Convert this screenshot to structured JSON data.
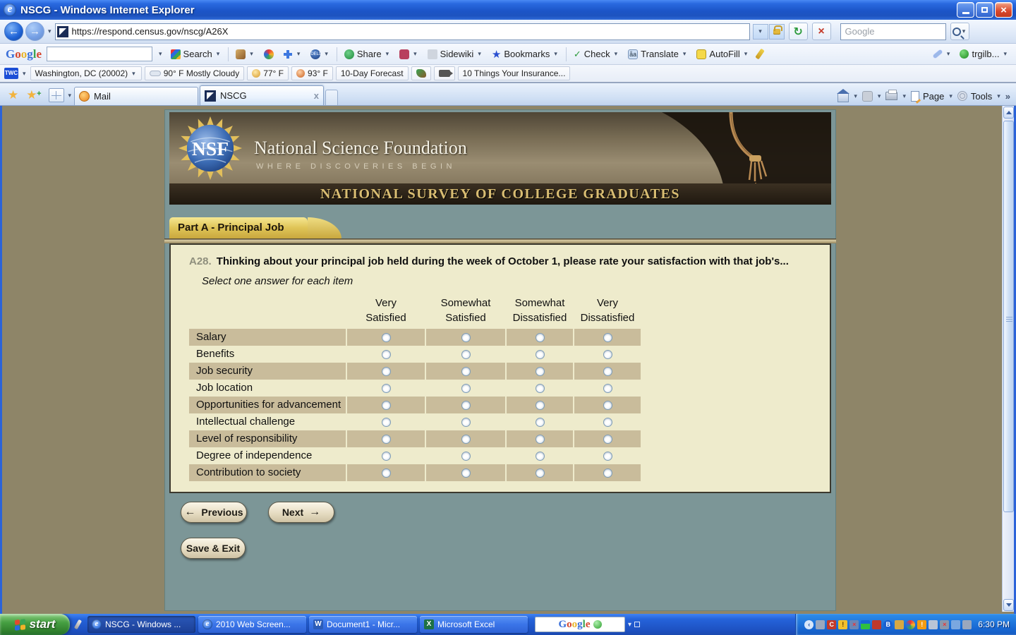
{
  "window": {
    "title": "NSCG - Windows Internet Explorer"
  },
  "nav": {
    "url": "https://respond.census.gov/nscg/A26X",
    "search_placeholder": "Google"
  },
  "google_toolbar": {
    "logo": "Google",
    "search_label": "Search",
    "share_label": "Share",
    "sidewiki_label": "Sidewiki",
    "bookmarks_label": "Bookmarks",
    "check_label": "Check",
    "translate_label": "Translate",
    "autofill_label": "AutoFill",
    "account_label": "trgilb..."
  },
  "weather_toolbar": {
    "brand": "TWC",
    "location": "Washington, DC (20002)",
    "conditions": "90° F Mostly Cloudy",
    "low": "77° F",
    "high": "93° F",
    "forecast_label": "10-Day Forecast",
    "headline": "10 Things Your Insurance..."
  },
  "tabs": {
    "mail": "Mail",
    "nscg": "NSCG"
  },
  "command_bar": {
    "page_label": "Page",
    "tools_label": "Tools"
  },
  "banner": {
    "logo_text": "NSF",
    "org_name": "National Science Foundation",
    "tagline": "WHERE DISCOVERIES BEGIN",
    "survey_title": "NATIONAL SURVEY OF COLLEGE GRADUATES"
  },
  "survey": {
    "section_tab": "Part A - Principal Job",
    "question_number": "A28.",
    "question_text": "Thinking about your principal job held during the week of October 1, please rate your satisfaction with that job's...",
    "instruction": "Select one answer for each item",
    "columns": [
      {
        "line1": "Very",
        "line2": "Satisfied"
      },
      {
        "line1": "Somewhat",
        "line2": "Satisfied"
      },
      {
        "line1": "Somewhat",
        "line2": "Dissatisfied"
      },
      {
        "line1": "Very",
        "line2": "Dissatisfied"
      }
    ],
    "rows": [
      "Salary",
      "Benefits",
      "Job security",
      "Job location",
      "Opportunities for advancement",
      "Intellectual challenge",
      "Level of responsibility",
      "Degree of independence",
      "Contribution to society"
    ],
    "previous_label": "Previous",
    "next_label": "Next",
    "save_exit_label": "Save & Exit"
  },
  "taskbar": {
    "start_label": "start",
    "tasks": [
      "NSCG - Windows ...",
      "2010 Web Screen...",
      "Document1 - Micr...",
      "Microsoft Excel"
    ],
    "deskband_logo": "Google",
    "clock": "6:30 PM"
  },
  "icons": {
    "back_arrow": "←",
    "forward_arrow": "→",
    "dropdown_arrow": "▾",
    "favorites_star": "★",
    "add_star": "★",
    "close_x": "×",
    "refresh": "↻",
    "stop_x": "×",
    "overflow_chevron": "»",
    "ie_e": "e",
    "word_w": "W",
    "excel_x": "X",
    "previous_arrow": "←",
    "next_arrow": "→"
  },
  "colors": {
    "xp_blue": "#2b63d9",
    "teal_panel": "#7c9697",
    "cream_panel": "#eeebcc",
    "tan_row": "#c9bc9b",
    "gold_tab": "#d9b94e",
    "banner_gold_text": "#d9bd72"
  }
}
